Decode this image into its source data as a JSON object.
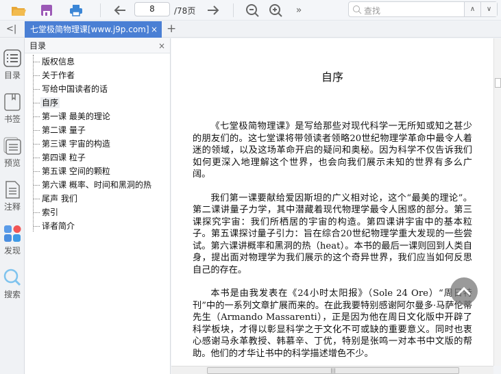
{
  "toolbar": {
    "page_current": "8",
    "page_total": "/78页",
    "search_placeholder": "查找",
    "more": "»",
    "up": "∧",
    "down": "∨"
  },
  "tabs": {
    "active": "七堂极简物理课[www.j9p.com]",
    "close": "×",
    "add": "+",
    "collapse": "<|"
  },
  "rail": [
    {
      "label": "目录",
      "icon": "list-icon"
    },
    {
      "label": "书签",
      "icon": "bookmark-icon"
    },
    {
      "label": "预览",
      "icon": "preview-icon"
    },
    {
      "label": "注释",
      "icon": "note-icon"
    },
    {
      "label": "发现",
      "icon": "discover-icon"
    },
    {
      "label": "搜索",
      "icon": "search-icon"
    }
  ],
  "toc": {
    "title": "目录",
    "close": "×",
    "items": [
      "版权信息",
      "关于作者",
      "写给中国读者的话",
      "自序",
      "第一课 最美的理论",
      "第二课 量子",
      "第三课 宇宙的构造",
      "第四课 粒子",
      "第五课 空间的颗粒",
      "第六课 概率、时间和黑洞的热",
      "尾声 我们",
      "索引",
      "译者简介"
    ],
    "active": "自序"
  },
  "document": {
    "title": "自序",
    "paragraphs": [
      "《七堂极简物理课》是写给那些对现代科学一无所知或知之甚少的朋友们的。这七堂课将带领读者领略20世纪物理学革命中最令人着迷的领域，以及这场革命开启的疑问和奥秘。因为科学不仅告诉我们如何更深入地理解这个世界，也会向我们展示未知的世界有多么广阔。",
      "我们第一课要献给爱因斯坦的广义相对论，这个“最美的理论”。第二课讲量子力学，其中潜藏着现代物理学最令人困惑的部分。第三课探究宇宙：我们所栖居的宇宙的构造。第四课讲宇宙中的基本粒子。第五课探讨量子引力：旨在综合20世纪物理学重大发现的一些尝试。第六课讲概率和黑洞的热（heat）。本书的最后一课则回到人类自身，提出面对物理学为我们展示的这个奇异世界，我们应当如何反思自己的存在。",
      "本书是由我发表在《24小时太阳报》（Sole 24 Ore）“周日特刊”中的一系列文章扩展而来的。在此我要特别感谢阿尔曼多·马萨伦蒂先生（Armando Massarenti），正是因为他在周日文化版中开辟了科学板块，才得以彰显科学之于文化不可或缺的重要意义。同时也衷心感谢马永革教授、韩慕辛、丁优，特别是张鸣一对本书中文版的帮助。他们的才华让书中的科学描述增色不少。"
    ]
  },
  "colors": {
    "accent": "#4a7fd4",
    "folder": "#e8a838",
    "save": "#9b59b6",
    "print": "#3b86d6"
  }
}
